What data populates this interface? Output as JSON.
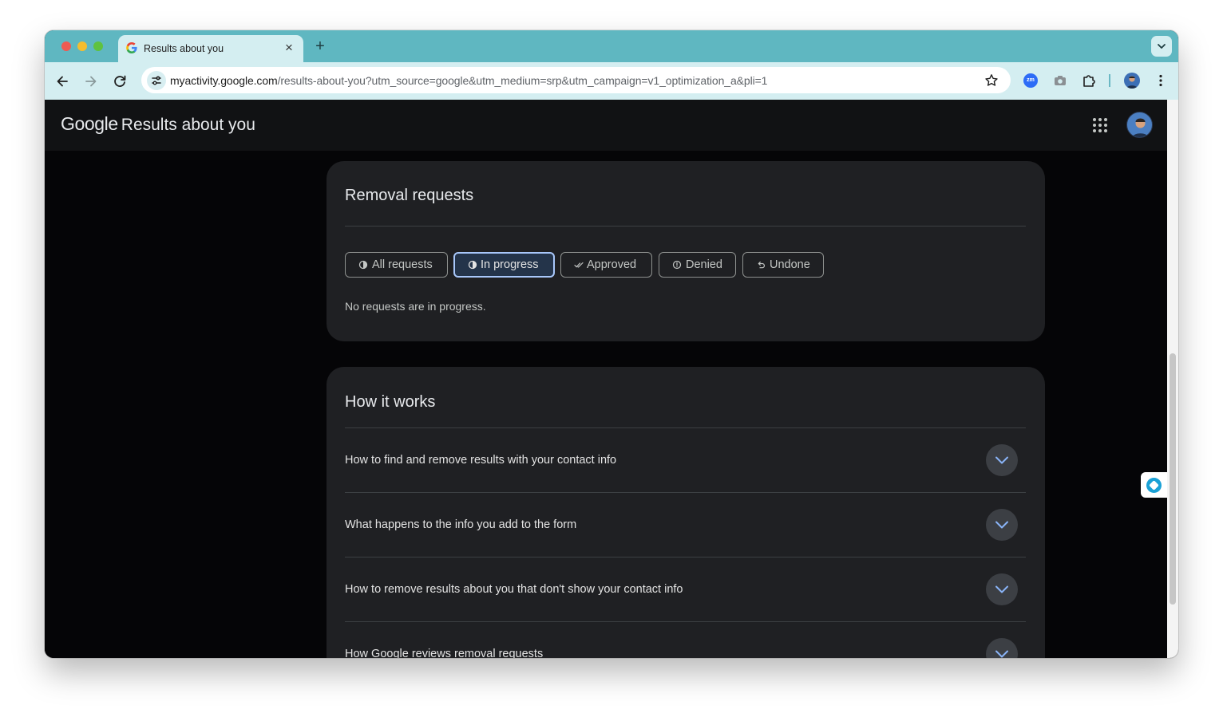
{
  "browser": {
    "tab_title": "Results about you",
    "url_host": "myactivity.google.com",
    "url_path": "/results-about-you?utm_source=google&utm_medium=srp&utm_campaign=v1_optimization_a&pli=1",
    "extension_zoom_label": "zm"
  },
  "header": {
    "google_wordmark": "Google",
    "product_name": "Results about you"
  },
  "removal_requests": {
    "title": "Removal requests",
    "filters": [
      {
        "label": "All requests",
        "icon": "half-circle-icon",
        "active": false
      },
      {
        "label": "In progress",
        "icon": "half-circle-icon",
        "active": true
      },
      {
        "label": "Approved",
        "icon": "double-check-icon",
        "active": false
      },
      {
        "label": "Denied",
        "icon": "info-circle-icon",
        "active": false
      },
      {
        "label": "Undone",
        "icon": "undo-icon",
        "active": false
      }
    ],
    "empty_message": "No requests are in progress."
  },
  "how_it_works": {
    "title": "How it works",
    "items": [
      {
        "question": "How to find and remove results with your contact info"
      },
      {
        "question": "What happens to the info you add to the form"
      },
      {
        "question": "How to remove results about you that don't show your contact info"
      },
      {
        "question": "How Google reviews removal requests"
      }
    ]
  },
  "colors": {
    "tab_strip": "#5fb7c1",
    "toolbar": "#d4eef1",
    "page_background": "#050507",
    "card_background": "#1f2023",
    "active_chip_border": "#a8c7fa",
    "expand_chevron": "#8ab4f8"
  }
}
